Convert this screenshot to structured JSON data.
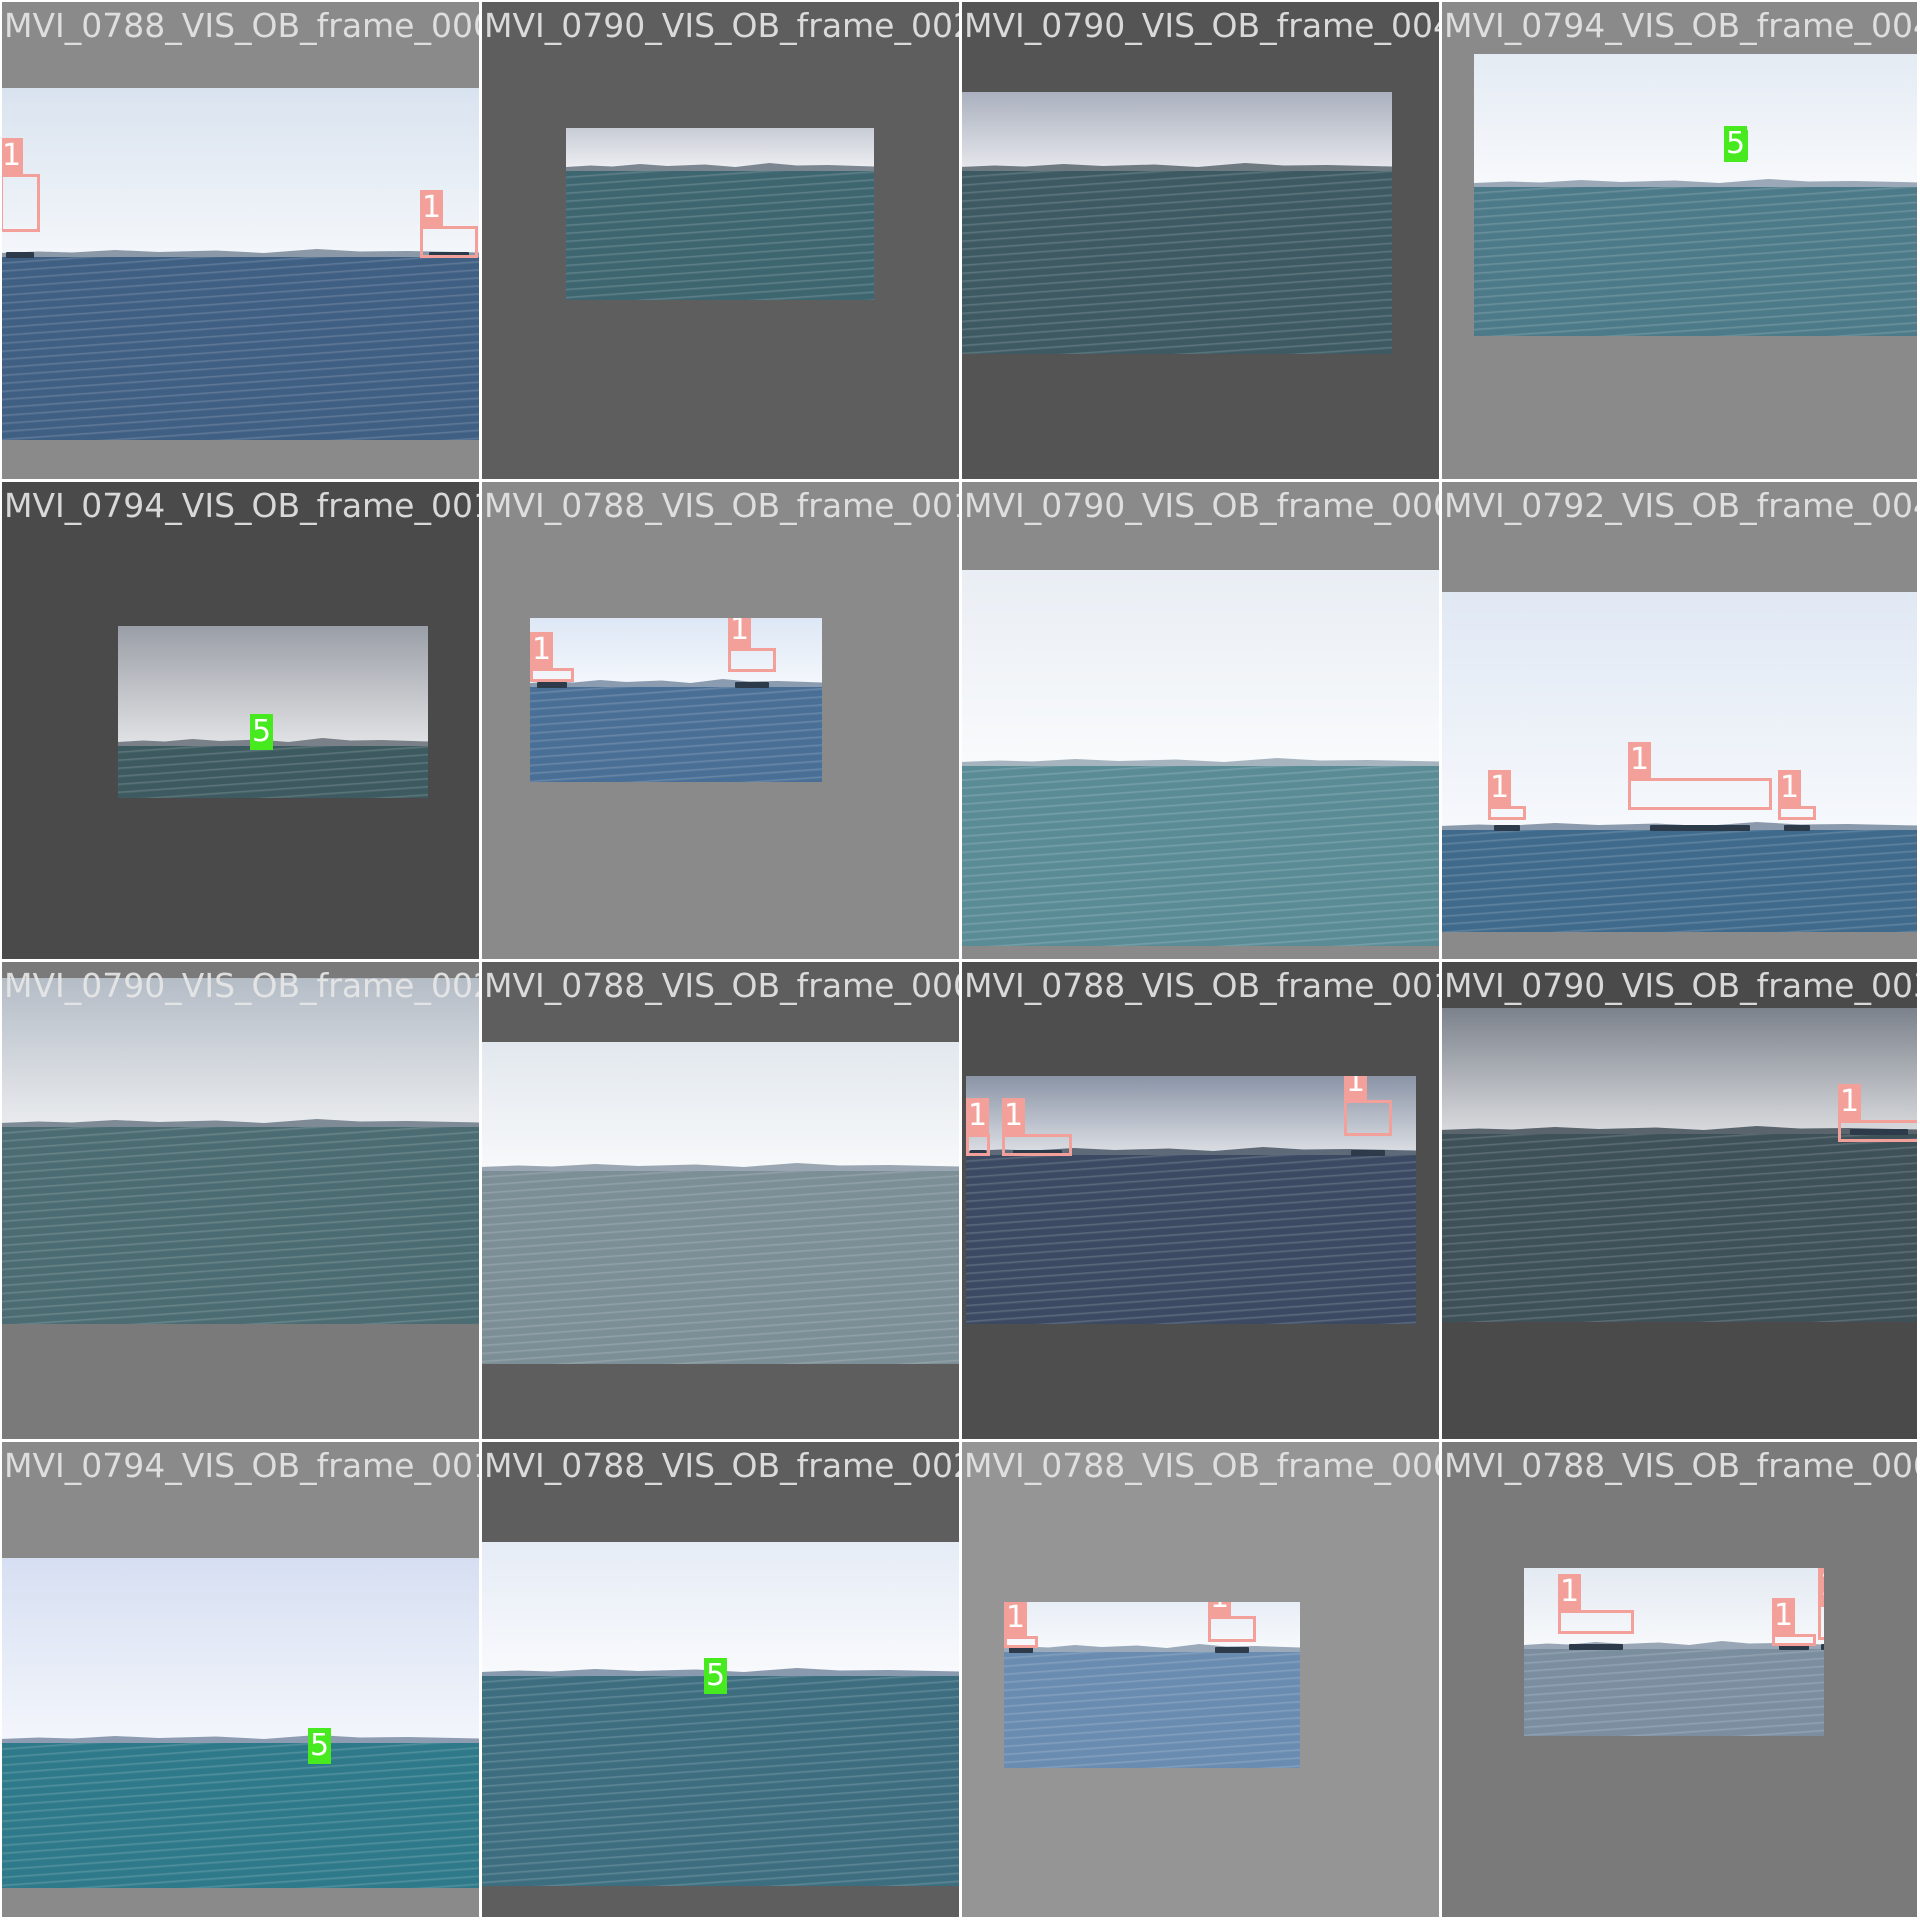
{
  "colors": {
    "background": "#ffffff",
    "label_text": "#e8e8e8",
    "class_1": "#f4a09a",
    "class_5": "#46ea1f"
  },
  "mosaic": {
    "cells": [
      {
        "filename": "MVI_0788_VIS_OB_frame_0001.jpg",
        "pad": "#8a8a8a",
        "palette": {
          "sky": "#d9e3ef",
          "land": "#8a98a8",
          "sea": "#3f5f83"
        },
        "detections": [
          {
            "class": "1"
          },
          {
            "class": "1"
          }
        ]
      },
      {
        "filename": "MVI_0790_VIS_OB_frame_0024.jpg",
        "pad": "#5e5e5e",
        "palette": {
          "sky": "#c8ccd6",
          "land": "#7c8690",
          "sea": "#3e6670"
        },
        "detections": []
      },
      {
        "filename": "MVI_0790_VIS_OB_frame_0048.jpg",
        "pad": "#545454",
        "palette": {
          "sky": "#aab0be",
          "land": "#6e7a80",
          "sea": "#3d5a62"
        },
        "detections": []
      },
      {
        "filename": "MVI_0794_VIS_OB_frame_0041.jpg",
        "pad": "#8a8a8a",
        "palette": {
          "sky": "#e4ebf4",
          "land": "#9aa8b8",
          "sea": "#4d7a88"
        },
        "detections": [
          {
            "class": "5"
          }
        ]
      },
      {
        "filename": "MVI_0794_VIS_OB_frame_0012.jpg",
        "pad": "#4a4a4a",
        "palette": {
          "sky": "#9a9ea6",
          "land": "#7a8088",
          "sea": "#3c5a60"
        },
        "detections": [
          {
            "class": "5"
          }
        ]
      },
      {
        "filename": "MVI_0788_VIS_OB_frame_0013.jpg",
        "pad": "#8a8a8a",
        "palette": {
          "sky": "#dde7f5",
          "land": "#8c9cb0",
          "sea": "#4a6f96"
        },
        "detections": [
          {
            "class": "1"
          },
          {
            "class": "1"
          }
        ]
      },
      {
        "filename": "MVI_0790_VIS_OB_frame_0006.jpg",
        "pad": "#8a8a8a",
        "palette": {
          "sky": "#e9eef4",
          "land": "#a6b4c0",
          "sea": "#5a8c96"
        },
        "detections": []
      },
      {
        "filename": "MVI_0792_VIS_OB_frame_0043.jpg",
        "pad": "#8a8a8a",
        "palette": {
          "sky": "#e0e8f4",
          "land": "#8a9aac",
          "sea": "#3f6a8c"
        },
        "detections": [
          {
            "class": "1"
          },
          {
            "class": "1"
          },
          {
            "class": "1"
          }
        ]
      },
      {
        "filename": "MVI_0790_VIS_OB_frame_0024.jpg",
        "pad": "#7a7a7a",
        "palette": {
          "sky": "#b4bcc6",
          "land": "#7e8a96",
          "sea": "#4a6c72"
        },
        "detections": []
      },
      {
        "filename": "MVI_0788_VIS_OB_frame_0009.jpg",
        "pad": "#5e5e5e",
        "palette": {
          "sky": "#e2e8ee",
          "land": "#9aa6b2",
          "sea": "#7c8e96"
        },
        "detections": []
      },
      {
        "filename": "MVI_0788_VIS_OB_frame_0013.jpg",
        "pad": "#4e4e4e",
        "palette": {
          "sky": "#8a94a6",
          "land": "#5e6a78",
          "sea": "#3b4a62"
        },
        "detections": [
          {
            "class": "1"
          },
          {
            "class": "1"
          },
          {
            "class": "1"
          }
        ]
      },
      {
        "filename": "MVI_0790_VIS_OB_frame_0030.jpg",
        "pad": "#4a4a4a",
        "palette": {
          "sky": "#7c828c",
          "land": "#5a646c",
          "sea": "#3e5058"
        },
        "detections": [
          {
            "class": "1"
          }
        ]
      },
      {
        "filename": "MVI_0794_VIS_OB_frame_0010.jpg",
        "pad": "#8a8a8a",
        "palette": {
          "sky": "#d6dff2",
          "land": "#8e9cb2",
          "sea": "#2f7a8a"
        },
        "detections": [
          {
            "class": "5"
          }
        ]
      },
      {
        "filename": "MVI_0788_VIS_OB_frame_0027.jpg",
        "pad": "#5e5e5e",
        "palette": {
          "sky": "#e6ecf6",
          "land": "#8a9aae",
          "sea": "#3d6e80"
        },
        "detections": [
          {
            "class": "5"
          }
        ]
      },
      {
        "filename": "MVI_0788_VIS_OB_frame_0004.jpg",
        "pad": "#959595",
        "palette": {
          "sky": "#e8eef6",
          "land": "#9aaabb",
          "sea": "#6a8cb0"
        },
        "detections": [
          {
            "class": "1"
          },
          {
            "class": "1"
          }
        ]
      },
      {
        "filename": "MVI_0788_VIS_OB_frame_0004.jpg",
        "pad": "#7a7a7a",
        "palette": {
          "sky": "#e4eaf2",
          "land": "#98a6b6",
          "sea": "#7a8ea0"
        },
        "detections": [
          {
            "class": "1"
          },
          {
            "class": "1"
          },
          {
            "class": "1"
          }
        ]
      }
    ]
  }
}
